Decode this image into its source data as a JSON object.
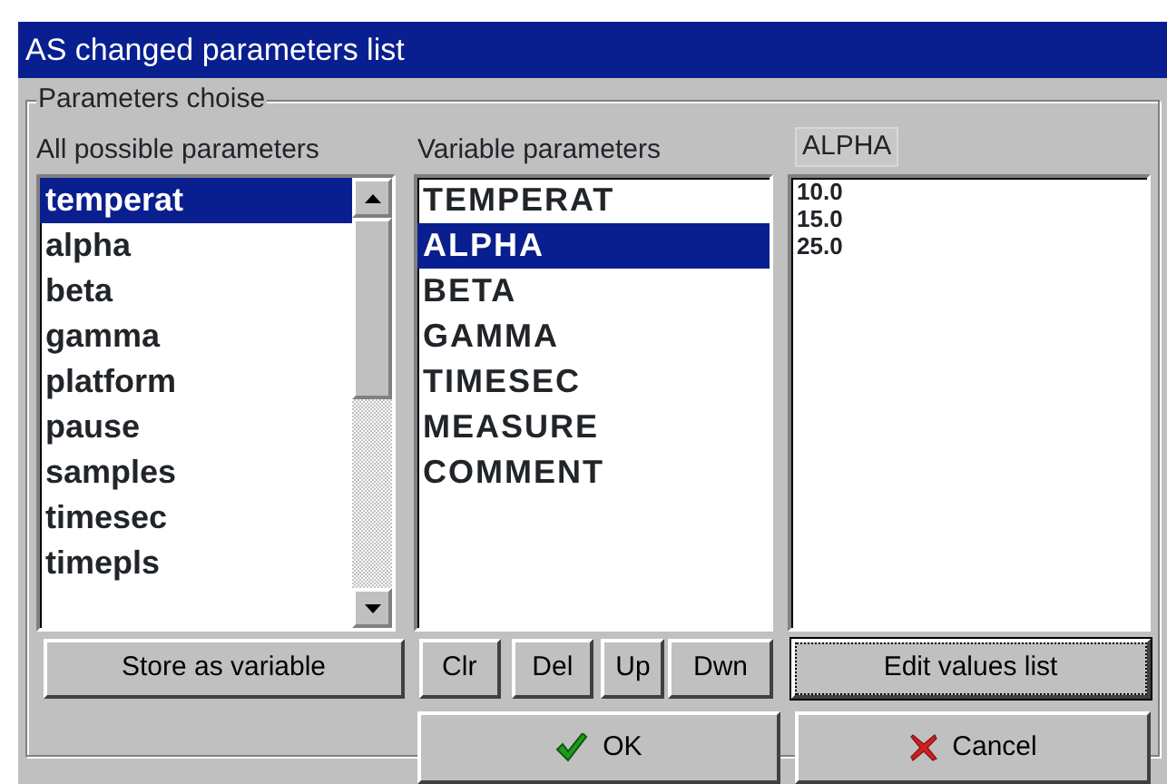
{
  "window": {
    "title": "AS changed parameters list"
  },
  "group": {
    "title": "Parameters choise"
  },
  "all_parameters": {
    "label": "All possible parameters",
    "items": [
      {
        "text": "temperat",
        "selected": true
      },
      {
        "text": "alpha",
        "selected": false
      },
      {
        "text": "beta",
        "selected": false
      },
      {
        "text": "gamma",
        "selected": false
      },
      {
        "text": "platform",
        "selected": false
      },
      {
        "text": "pause",
        "selected": false
      },
      {
        "text": "samples",
        "selected": false
      },
      {
        "text": "timesec",
        "selected": false
      },
      {
        "text": "timepls",
        "selected": false
      }
    ]
  },
  "variable_parameters": {
    "label": "Variable parameters",
    "items": [
      {
        "text": "TEMPERAT",
        "selected": false
      },
      {
        "text": "ALPHA",
        "selected": true
      },
      {
        "text": "BETA",
        "selected": false
      },
      {
        "text": "GAMMA",
        "selected": false
      },
      {
        "text": "TIMESEC",
        "selected": false
      },
      {
        "text": "MEASURE",
        "selected": false
      },
      {
        "text": "COMMENT",
        "selected": false
      }
    ]
  },
  "values": {
    "label": "ALPHA",
    "items": [
      "10.0",
      "15.0",
      "25.0"
    ]
  },
  "list_buttons": [
    {
      "label": "Store as variable",
      "focused": false
    },
    {
      "label": "Clr",
      "focused": false
    },
    {
      "label": "Del",
      "focused": false
    },
    {
      "label": "Up",
      "focused": false
    },
    {
      "label": "Dwn",
      "focused": false
    },
    {
      "label": "Edit values list",
      "focused": true
    }
  ],
  "dialog_buttons": [
    {
      "label": "OK",
      "kind": "ok"
    },
    {
      "label": "Cancel",
      "kind": "cancel"
    }
  ]
}
